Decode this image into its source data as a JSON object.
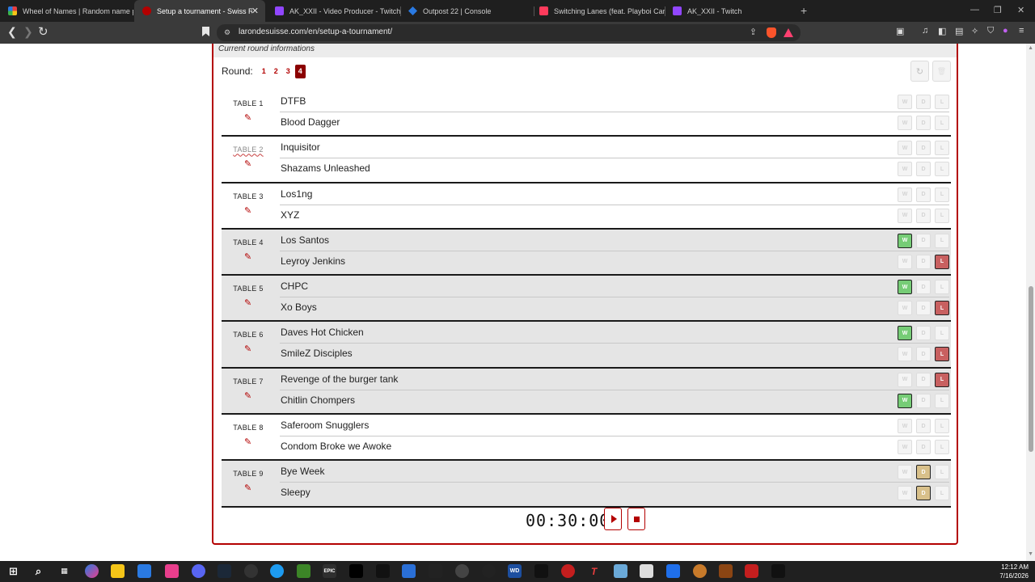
{
  "browser": {
    "tabs": [
      {
        "title": "Wheel of Names | Random name pic",
        "color": "#e83e3e"
      },
      {
        "title": "Setup a tournament - Swiss Rou",
        "color": "#b30000",
        "active": true
      },
      {
        "title": "AK_XXII - Video Producer - Twitch",
        "color": "#9146ff"
      },
      {
        "title": "Outpost 22 | Console",
        "color": "#2a7ae2"
      },
      {
        "title": "Switching Lanes (feat. Playboi Carti)",
        "color": "#ff3b5c"
      },
      {
        "title": "AK_XXII - Twitch",
        "color": "#9146ff"
      }
    ],
    "close_glyph": "✕",
    "new_tab_glyph": "+",
    "url": "larondesuisse.com/en/setup-a-tournament/",
    "back_glyph": "❮",
    "forward_glyph": "❯",
    "reload_glyph": "↻"
  },
  "section_heading": "Current round informations",
  "round": {
    "label": "Round:",
    "options": [
      "1",
      "2",
      "3",
      "4"
    ],
    "selected": "4"
  },
  "controls": {
    "refresh_glyph": "↻",
    "delete_glyph": "🗑"
  },
  "wdl_labels": {
    "win": "W",
    "draw": "D",
    "loss": "L"
  },
  "tables": [
    {
      "label": "TABLE 1",
      "teams": [
        {
          "name": "DTFB",
          "result": null
        },
        {
          "name": "Blood Dagger",
          "result": null
        }
      ]
    },
    {
      "label": "TABLE 2",
      "teams": [
        {
          "name": "Inquisitor",
          "result": null
        },
        {
          "name": "Shazams Unleashed",
          "result": null
        }
      ]
    },
    {
      "label": "TABLE 3",
      "teams": [
        {
          "name": "Los1ng",
          "result": null
        },
        {
          "name": "XYZ",
          "result": null
        }
      ]
    },
    {
      "label": "TABLE 4",
      "teams": [
        {
          "name": "Los Santos",
          "result": "W"
        },
        {
          "name": "Leyroy Jenkins",
          "result": "L"
        }
      ]
    },
    {
      "label": "TABLE 5",
      "teams": [
        {
          "name": "CHPC",
          "result": "W"
        },
        {
          "name": "Xo Boys",
          "result": "L"
        }
      ]
    },
    {
      "label": "TABLE 6",
      "teams": [
        {
          "name": "Daves Hot Chicken",
          "result": "W"
        },
        {
          "name": "SmileZ Disciples",
          "result": "L"
        }
      ]
    },
    {
      "label": "TABLE 7",
      "teams": [
        {
          "name": "Revenge of the burger tank",
          "result": "L"
        },
        {
          "name": "Chitlin Chompers",
          "result": "W"
        }
      ]
    },
    {
      "label": "TABLE 8",
      "teams": [
        {
          "name": "Saferoom Snugglers",
          "result": null
        },
        {
          "name": "Condom Broke we Awoke",
          "result": null
        }
      ]
    },
    {
      "label": "TABLE 9",
      "teams": [
        {
          "name": "Bye Week",
          "result": "D"
        },
        {
          "name": "Sleepy",
          "result": "D"
        }
      ]
    }
  ],
  "timer": {
    "value": "00:30:00"
  },
  "taskbar": {
    "time": "12:12 AM",
    "date": "7/16/2026"
  }
}
